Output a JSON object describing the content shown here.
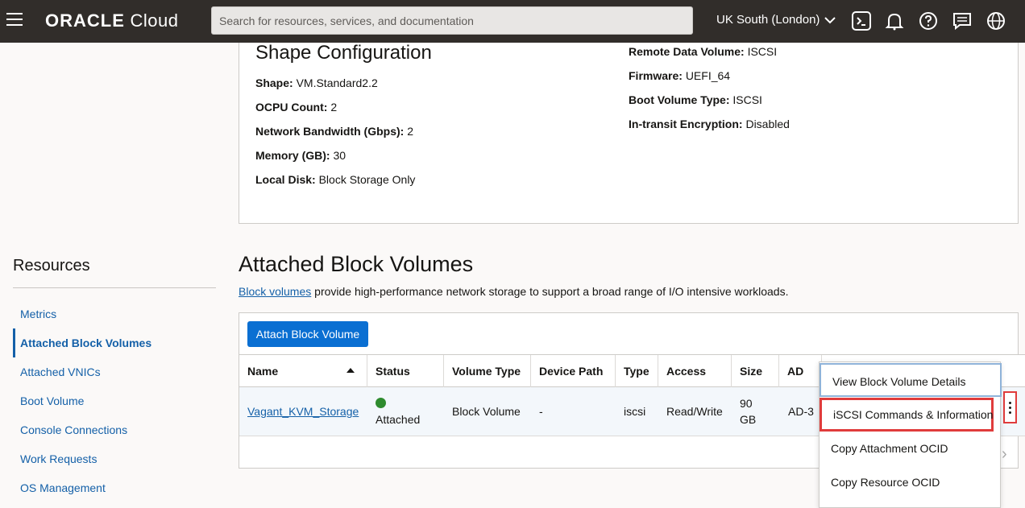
{
  "header": {
    "logo_oracle": "ORACLE",
    "logo_cloud": "Cloud",
    "search_placeholder": "Search for resources, services, and documentation",
    "region": "UK South (London)"
  },
  "shape": {
    "title": "Shape Configuration",
    "left": [
      {
        "key": "Shape:",
        "value": "VM.Standard2.2"
      },
      {
        "key": "OCPU Count:",
        "value": "2"
      },
      {
        "key": "Network Bandwidth (Gbps):",
        "value": "2"
      },
      {
        "key": "Memory (GB):",
        "value": "30"
      },
      {
        "key": "Local Disk:",
        "value": "Block Storage Only"
      }
    ],
    "right": [
      {
        "key": "Remote Data Volume:",
        "value": "ISCSI"
      },
      {
        "key": "Firmware:",
        "value": "UEFI_64"
      },
      {
        "key": "Boot Volume Type:",
        "value": "ISCSI"
      },
      {
        "key": "In-transit Encryption:",
        "value": "Disabled"
      }
    ]
  },
  "resources": {
    "title": "Resources",
    "items": [
      "Metrics",
      "Attached Block Volumes",
      "Attached VNICs",
      "Boot Volume",
      "Console Connections",
      "Work Requests",
      "OS Management"
    ]
  },
  "abv": {
    "title": "Attached Block Volumes",
    "desc_link": "Block volumes",
    "desc_rest": " provide high-performance network storage to support a broad range of I/O intensive workloads.",
    "attach_button": "Attach Block Volume",
    "columns": [
      "Name",
      "Status",
      "Volume Type",
      "Device Path",
      "Type",
      "Access",
      "Size",
      "AD"
    ],
    "row": {
      "name": "Vagant_KVM_Storage",
      "status": "Attached",
      "volume_type": "Block Volume",
      "device_path": "-",
      "type": "iscsi",
      "access": "Read/Write",
      "size_line1": "90",
      "size_line2": "GB",
      "ad": "AD-3"
    }
  },
  "menu": {
    "items": [
      "View Block Volume Details",
      "iSCSI Commands & Information",
      "Copy Attachment OCID",
      "Copy Resource OCID"
    ]
  }
}
